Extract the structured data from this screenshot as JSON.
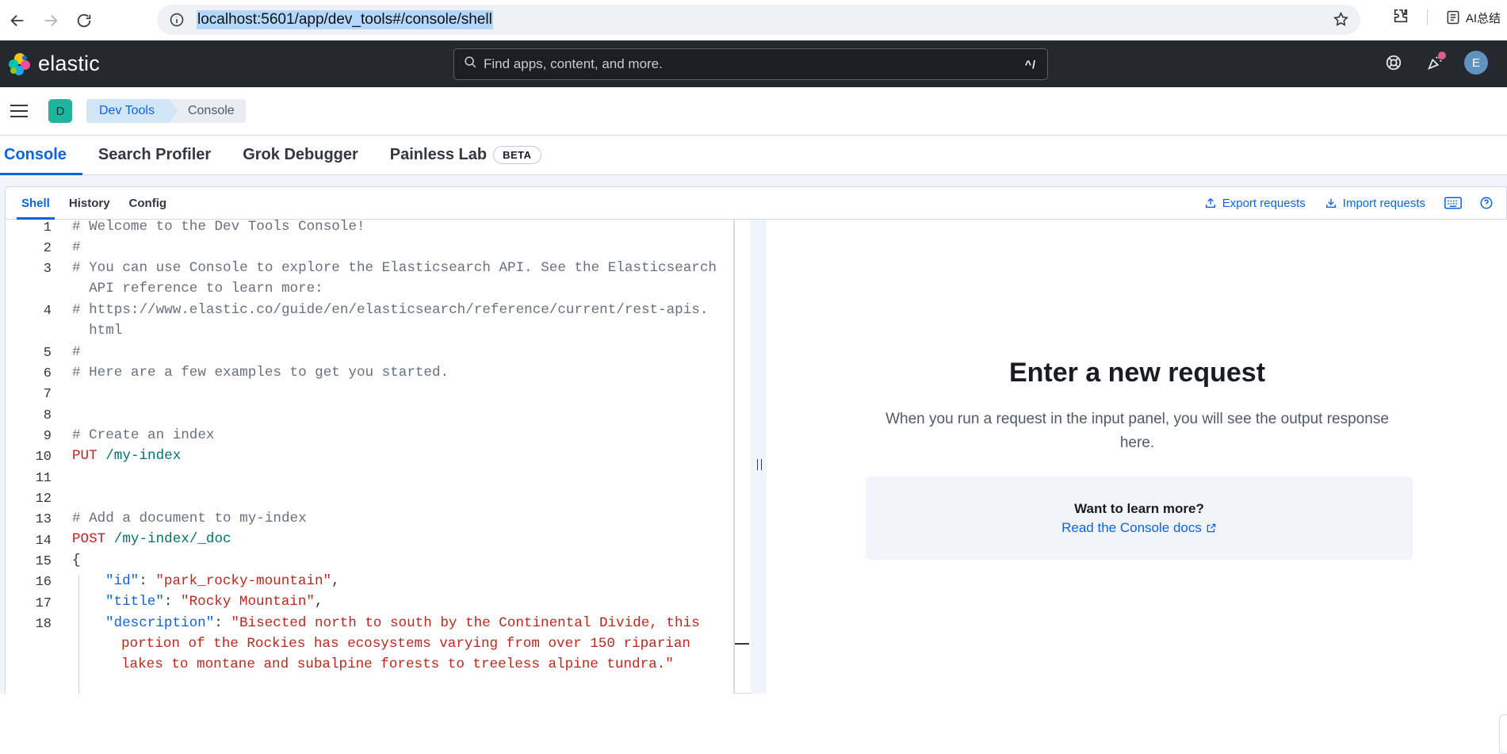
{
  "browser": {
    "url": "localhost:5601/app/dev_tools#/console/shell",
    "ai_summary_label": "AI总结"
  },
  "header": {
    "logo_text": "elastic",
    "search_placeholder": "Find apps, content, and more.",
    "search_shortcut": "^/",
    "avatar_initial": "E"
  },
  "breadcrumbs": {
    "space_initial": "D",
    "items": [
      "Dev Tools",
      "Console"
    ]
  },
  "main_tabs": [
    {
      "label": "Console",
      "active": true
    },
    {
      "label": "Search Profiler",
      "active": false
    },
    {
      "label": "Grok Debugger",
      "active": false
    },
    {
      "label": "Painless Lab",
      "active": false
    }
  ],
  "beta_label": "BETA",
  "console_tabs": [
    {
      "label": "Shell",
      "active": true
    },
    {
      "label": "History",
      "active": false
    },
    {
      "label": "Config",
      "active": false
    }
  ],
  "actions": {
    "export": "Export requests",
    "import": "Import requests"
  },
  "editor": {
    "line_numbers": [
      "1",
      "2",
      "3",
      "",
      "4",
      "",
      "5",
      "6",
      "7",
      "8",
      "9",
      "10",
      "11",
      "12",
      "13",
      "14",
      "15",
      "16",
      "17",
      "18",
      "",
      ""
    ],
    "lines": [
      "# Welcome to the Dev Tools Console!",
      "#",
      "# You can use Console to explore the Elasticsearch API. See the Elasticsearch",
      "  API reference to learn more:",
      "# https://www.elastic.co/guide/en/elasticsearch/reference/current/rest-apis.",
      "  html",
      "#",
      "# Here are a few examples to get you started.",
      "",
      "",
      "# Create an index",
      "PUT",
      " /my-index",
      "",
      "",
      "# Add a document to my-index",
      "POST",
      " /my-index/_doc",
      "{",
      "\"id\"",
      "\"park_rocky-mountain\"",
      "\"title\"",
      "\"Rocky Mountain\"",
      "\"description\"",
      "\"Bisected north to south by the Continental Divide, this",
      "portion of the Rockies has ecosystems varying from over 150 riparian",
      "lakes to montane and subalpine forests to treeless alpine tundra.\"",
      ": ",
      ","
    ]
  },
  "output": {
    "title": "Enter a new request",
    "description": "When you run a request in the input panel, you will see the output response here.",
    "learn_question": "Want to learn more?",
    "learn_link": "Read the Console docs"
  }
}
